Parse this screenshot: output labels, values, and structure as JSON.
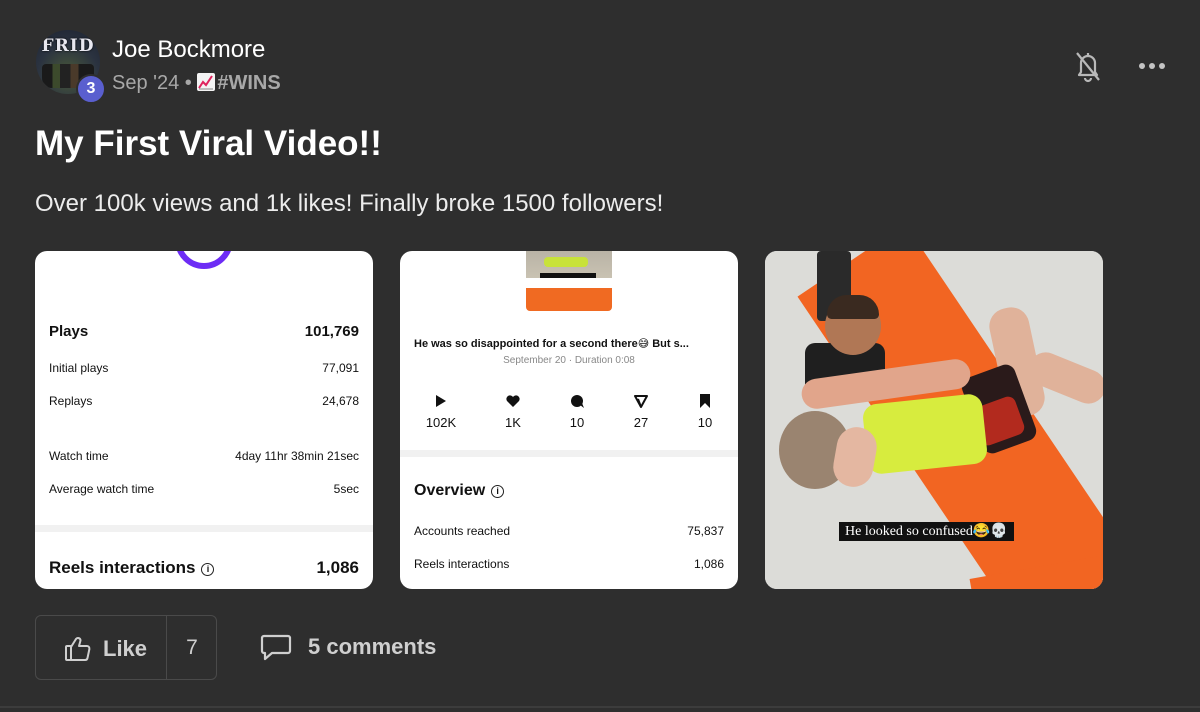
{
  "author": {
    "name": "Joe Bockmore",
    "level": "3",
    "avatar_text": "FRID"
  },
  "meta": {
    "date": "Sep '24",
    "separator": "•",
    "category": "#WINS",
    "category_icon": "chart-increasing-icon"
  },
  "post": {
    "title": "My First Viral Video!!",
    "body": "Over 100k views and 1k likes! Finally broke 1500 followers!"
  },
  "images": {
    "stats": {
      "plays_label": "Plays",
      "plays_value": "101,769",
      "initial_label": "Initial plays",
      "initial_value": "77,091",
      "replays_label": "Replays",
      "replays_value": "24,678",
      "watch_label": "Watch time",
      "watch_value": "4day 11hr 38min 21sec",
      "avg_label": "Average watch time",
      "avg_value": "5sec",
      "reels_label": "Reels interactions",
      "reels_value": "1,086"
    },
    "overview": {
      "caption": "He was so disappointed for a second there😅 But s...",
      "video_meta": "September 20 · Duration 0:08",
      "metrics": [
        {
          "icon": "play-icon",
          "value": "102K"
        },
        {
          "icon": "heart-icon",
          "value": "1K"
        },
        {
          "icon": "comment-icon",
          "value": "10"
        },
        {
          "icon": "share-icon",
          "value": "27"
        },
        {
          "icon": "bookmark-icon",
          "value": "10"
        }
      ],
      "section_title": "Overview",
      "reached_label": "Accounts reached",
      "reached_value": "75,837",
      "interactions_label": "Reels interactions",
      "interactions_value": "1,086"
    },
    "photo": {
      "caption": "He looked so confused😂💀"
    }
  },
  "actions": {
    "like_label": "Like",
    "like_count": "7",
    "comments_label": "5 comments"
  },
  "colors": {
    "background": "#2e2e2e",
    "badge": "#5a5fcf",
    "ring": "#6d2cf5",
    "mat_orange": "#f26522"
  }
}
